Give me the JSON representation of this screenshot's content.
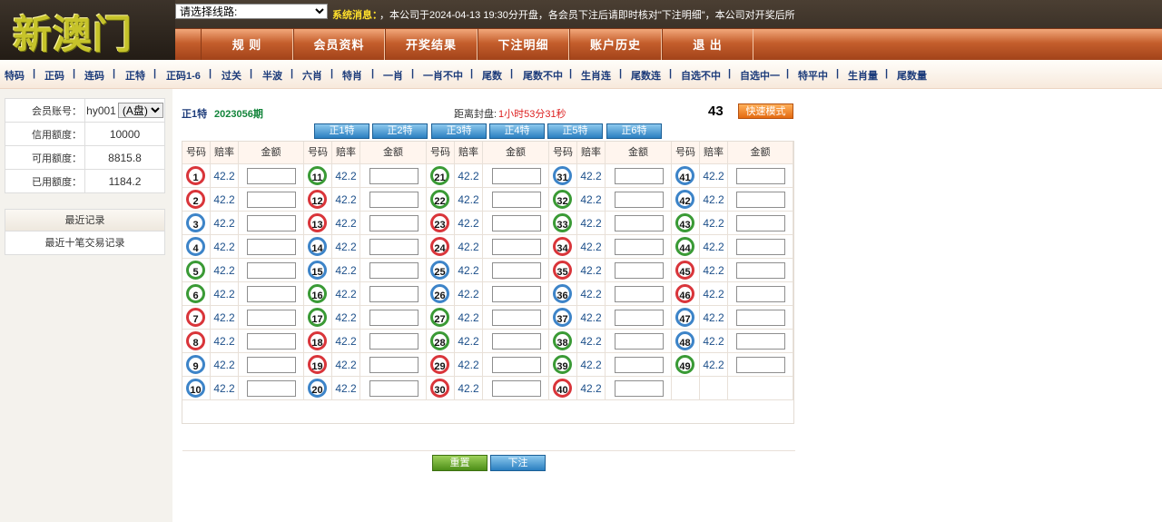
{
  "header": {
    "logo_text": "新澳门",
    "line_select_value": "请选择线路:",
    "system_label": "系统消息：",
    "system_message": "，本公司于2024-04-13 19:30分开盘，各会员下注后请即时核对\"下注明细\"，本公司对开奖后所",
    "nav": [
      "规 则",
      "会员资料",
      "开奖结果",
      "下注明细",
      "账户历史",
      "退 出"
    ]
  },
  "subnav": [
    "特码",
    "正码",
    "连码",
    "正特",
    "正码1-6",
    "过关",
    "半波",
    "六肖",
    "特肖",
    "一肖",
    "一肖不中",
    "尾数",
    "尾数不中",
    "生肖连",
    "尾数连",
    "自选不中",
    "自选中一",
    "特平中",
    "生肖量",
    "尾数量"
  ],
  "account": {
    "rows": [
      {
        "label": "会员账号：",
        "value": "hy001"
      },
      {
        "label": "信用额度：",
        "value": "10000"
      },
      {
        "label": "可用额度：",
        "value": "8815.8"
      },
      {
        "label": "已用额度：",
        "value": "1184.2"
      }
    ],
    "handicap": "(A盘)",
    "records_title": "最近记录",
    "records_link": "最近十笔交易记录"
  },
  "info": {
    "type": "正1特",
    "issue": "2023056期",
    "close_label": "距离封盘:",
    "close_time": "1小时53分31秒",
    "count": "43",
    "fast_mode": "快速模式"
  },
  "tabs": [
    "正1特",
    "正2特",
    "正3特",
    "正4特",
    "正5特",
    "正6特"
  ],
  "table": {
    "headers": [
      "号码",
      "赔率",
      "金额"
    ],
    "odds": "42.2"
  },
  "balls": {
    "colors": {
      "red": "#d9353a",
      "blue": "#3d84c8",
      "green": "#3a9a35"
    },
    "numbers": [
      {
        "n": "1",
        "c": "red"
      },
      {
        "n": "2",
        "c": "red"
      },
      {
        "n": "3",
        "c": "blue"
      },
      {
        "n": "4",
        "c": "blue"
      },
      {
        "n": "5",
        "c": "green"
      },
      {
        "n": "6",
        "c": "green"
      },
      {
        "n": "7",
        "c": "red"
      },
      {
        "n": "8",
        "c": "red"
      },
      {
        "n": "9",
        "c": "blue"
      },
      {
        "n": "10",
        "c": "blue"
      },
      {
        "n": "11",
        "c": "green"
      },
      {
        "n": "12",
        "c": "red"
      },
      {
        "n": "13",
        "c": "red"
      },
      {
        "n": "14",
        "c": "blue"
      },
      {
        "n": "15",
        "c": "blue"
      },
      {
        "n": "16",
        "c": "green"
      },
      {
        "n": "17",
        "c": "green"
      },
      {
        "n": "18",
        "c": "red"
      },
      {
        "n": "19",
        "c": "red"
      },
      {
        "n": "20",
        "c": "blue"
      },
      {
        "n": "21",
        "c": "green"
      },
      {
        "n": "22",
        "c": "green"
      },
      {
        "n": "23",
        "c": "red"
      },
      {
        "n": "24",
        "c": "red"
      },
      {
        "n": "25",
        "c": "blue"
      },
      {
        "n": "26",
        "c": "blue"
      },
      {
        "n": "27",
        "c": "green"
      },
      {
        "n": "28",
        "c": "green"
      },
      {
        "n": "29",
        "c": "red"
      },
      {
        "n": "30",
        "c": "red"
      },
      {
        "n": "31",
        "c": "blue"
      },
      {
        "n": "32",
        "c": "green"
      },
      {
        "n": "33",
        "c": "green"
      },
      {
        "n": "34",
        "c": "red"
      },
      {
        "n": "35",
        "c": "red"
      },
      {
        "n": "36",
        "c": "blue"
      },
      {
        "n": "37",
        "c": "blue"
      },
      {
        "n": "38",
        "c": "green"
      },
      {
        "n": "39",
        "c": "green"
      },
      {
        "n": "40",
        "c": "red"
      },
      {
        "n": "41",
        "c": "blue"
      },
      {
        "n": "42",
        "c": "blue"
      },
      {
        "n": "43",
        "c": "green"
      },
      {
        "n": "44",
        "c": "green"
      },
      {
        "n": "45",
        "c": "red"
      },
      {
        "n": "46",
        "c": "red"
      },
      {
        "n": "47",
        "c": "blue"
      },
      {
        "n": "48",
        "c": "blue"
      },
      {
        "n": "49",
        "c": "green"
      }
    ]
  },
  "buttons": {
    "reset": "重置",
    "bet": "下注"
  }
}
